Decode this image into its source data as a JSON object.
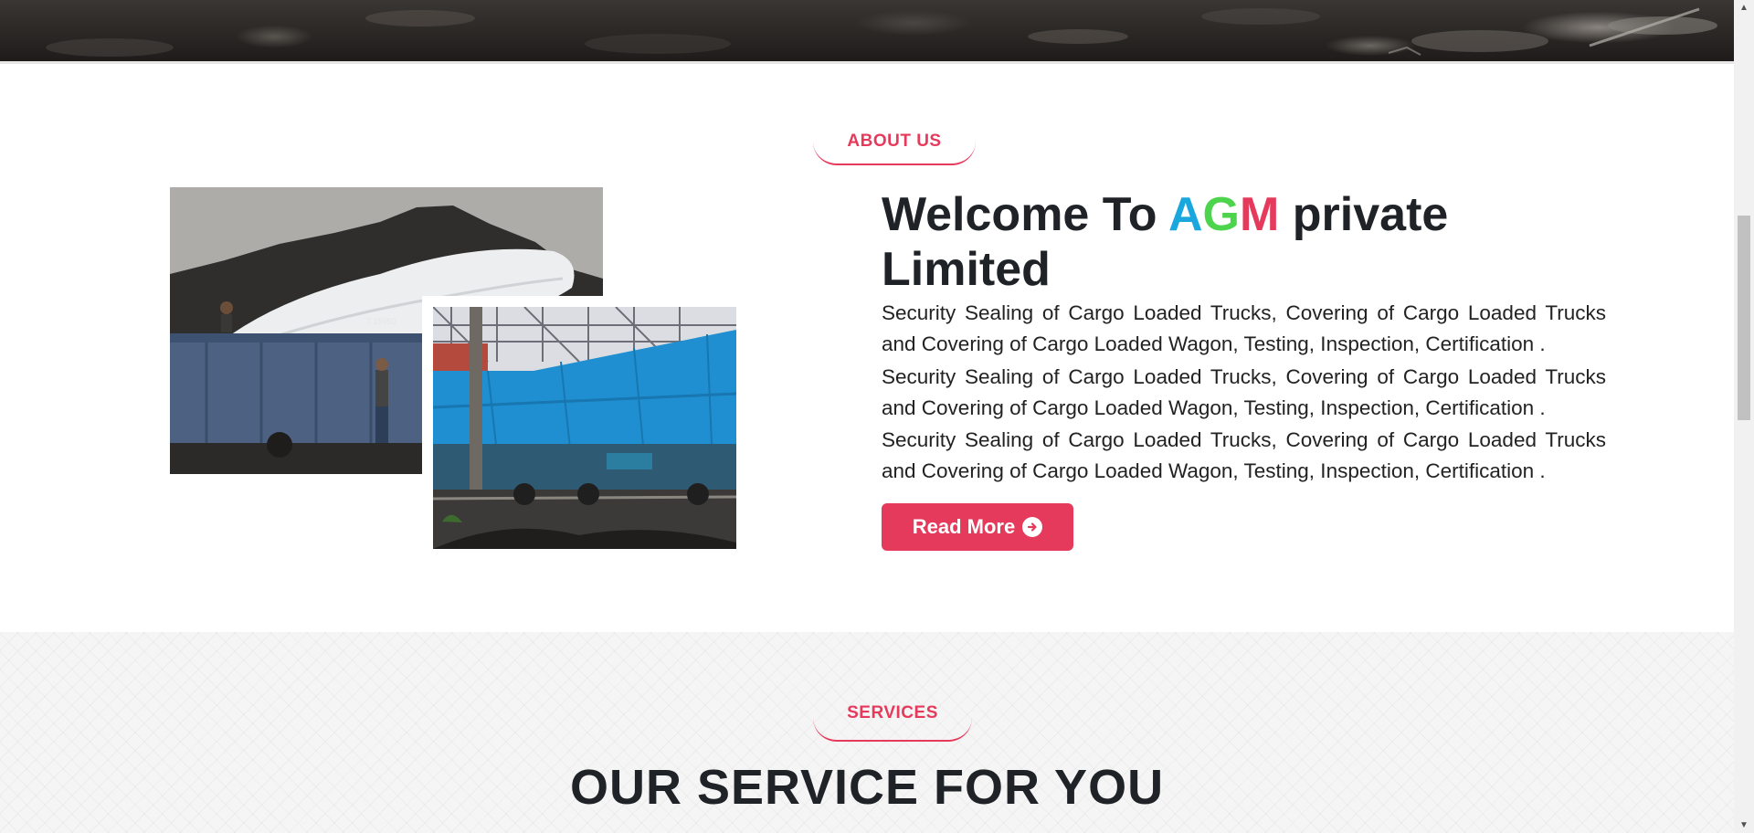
{
  "about": {
    "tag": "ABOUT US",
    "welcome_prefix": "Welcome To ",
    "brand_a": "A",
    "brand_g": "G",
    "brand_m": "M",
    "welcome_suffix": " private Limited",
    "paragraphs": [
      "Security Sealing of Cargo Loaded Trucks, Covering of Cargo Loaded Trucks and Covering of Cargo Loaded Wagon, Testing, Inspection, Certification .",
      "Security Sealing of Cargo Loaded Trucks, Covering of Cargo Loaded Trucks and Covering of Cargo Loaded Wagon, Testing, Inspection, Certification .",
      "Security Sealing of Cargo Loaded Trucks, Covering of Cargo Loaded Trucks and Covering of Cargo Loaded Wagon, Testing, Inspection, Certification ."
    ],
    "read_more_label": "Read More",
    "read_more_icon": "arrow-circle-right-icon"
  },
  "services": {
    "tag": "SERVICES",
    "title": "OUR SERVICE FOR YOU"
  },
  "colors": {
    "accent": "#e63a5c",
    "brand_a": "#1aa7de",
    "brand_g": "#4cd44c",
    "brand_m": "#e63a5c",
    "heading": "#1f2226"
  }
}
